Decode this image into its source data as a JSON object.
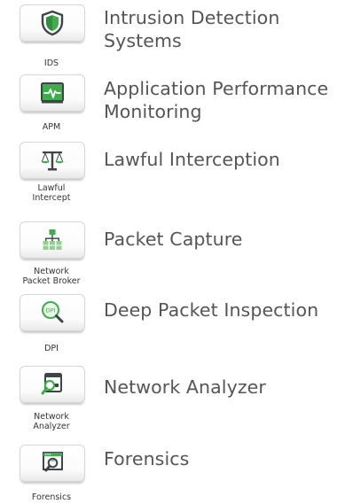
{
  "colors": {
    "accent_green": "#3dae49",
    "icon_dark": "#3d4549",
    "title_text": "#555555",
    "caption_text": "#333333"
  },
  "items": [
    {
      "icon": "shield-icon",
      "caption": "IDS",
      "title_line1": "Intrusion Detection",
      "title_line2": "Systems"
    },
    {
      "icon": "heartbeat-monitor-icon",
      "caption": "APM",
      "title_line1": "Application Performance",
      "title_line2": "Monitoring"
    },
    {
      "icon": "scales-icon",
      "caption_line1": "Lawful",
      "caption_line2": "Intercept",
      "title_line1": "Lawful Interception"
    },
    {
      "icon": "network-hierarchy-icon",
      "caption_line1": "Network",
      "caption_line2": "Packet Broker",
      "title_line1": "Packet Capture"
    },
    {
      "icon": "dpi-magnifier-icon",
      "caption": "DPI",
      "badge": "DPI",
      "title_line1": "Deep Packet Inspection"
    },
    {
      "icon": "network-analyzer-icon",
      "caption_line1": "Network",
      "caption_line2": "Analyzer",
      "title_line1": "Network Analyzer"
    },
    {
      "icon": "forensics-window-icon",
      "caption": "Forensics",
      "title_line1": "Forensics"
    }
  ]
}
